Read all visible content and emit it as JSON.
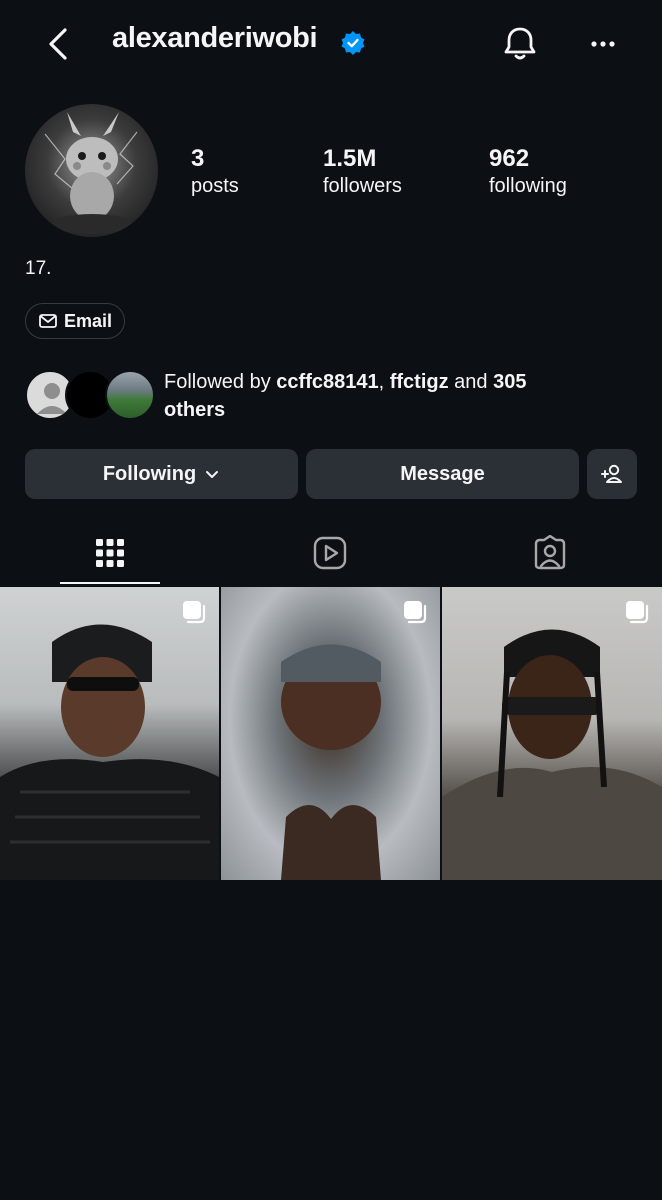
{
  "header": {
    "username": "alexanderiwobi",
    "verified": true,
    "back_icon": "chevron-left-icon",
    "bell_icon": "bell-icon",
    "more_icon": "more-horizontal-icon"
  },
  "profile": {
    "stats": [
      {
        "value": "3",
        "label": "posts"
      },
      {
        "value": "1.5M",
        "label": "followers"
      },
      {
        "value": "962",
        "label": "following"
      }
    ],
    "bio": "17.",
    "email_label": "Email"
  },
  "followed_by": {
    "prefix": "Followed by ",
    "user1": "ccffc88141",
    "sep": ", ",
    "user2": "ffctigz",
    "mid": " and ",
    "count": "305",
    "line2": "others"
  },
  "actions": {
    "following_label": "Following",
    "message_label": "Message",
    "add_person_icon": "add-person-icon"
  },
  "tabs": [
    {
      "name": "posts",
      "icon": "grid-icon",
      "active": true
    },
    {
      "name": "reels",
      "icon": "reels-icon",
      "active": false
    },
    {
      "name": "tagged",
      "icon": "tagged-icon",
      "active": false
    }
  ],
  "posts": [
    {
      "multi": true
    },
    {
      "multi": true
    },
    {
      "multi": true
    }
  ],
  "colors": {
    "background": "#0c1014",
    "button": "#2b3036",
    "verified": "#0095f6"
  }
}
